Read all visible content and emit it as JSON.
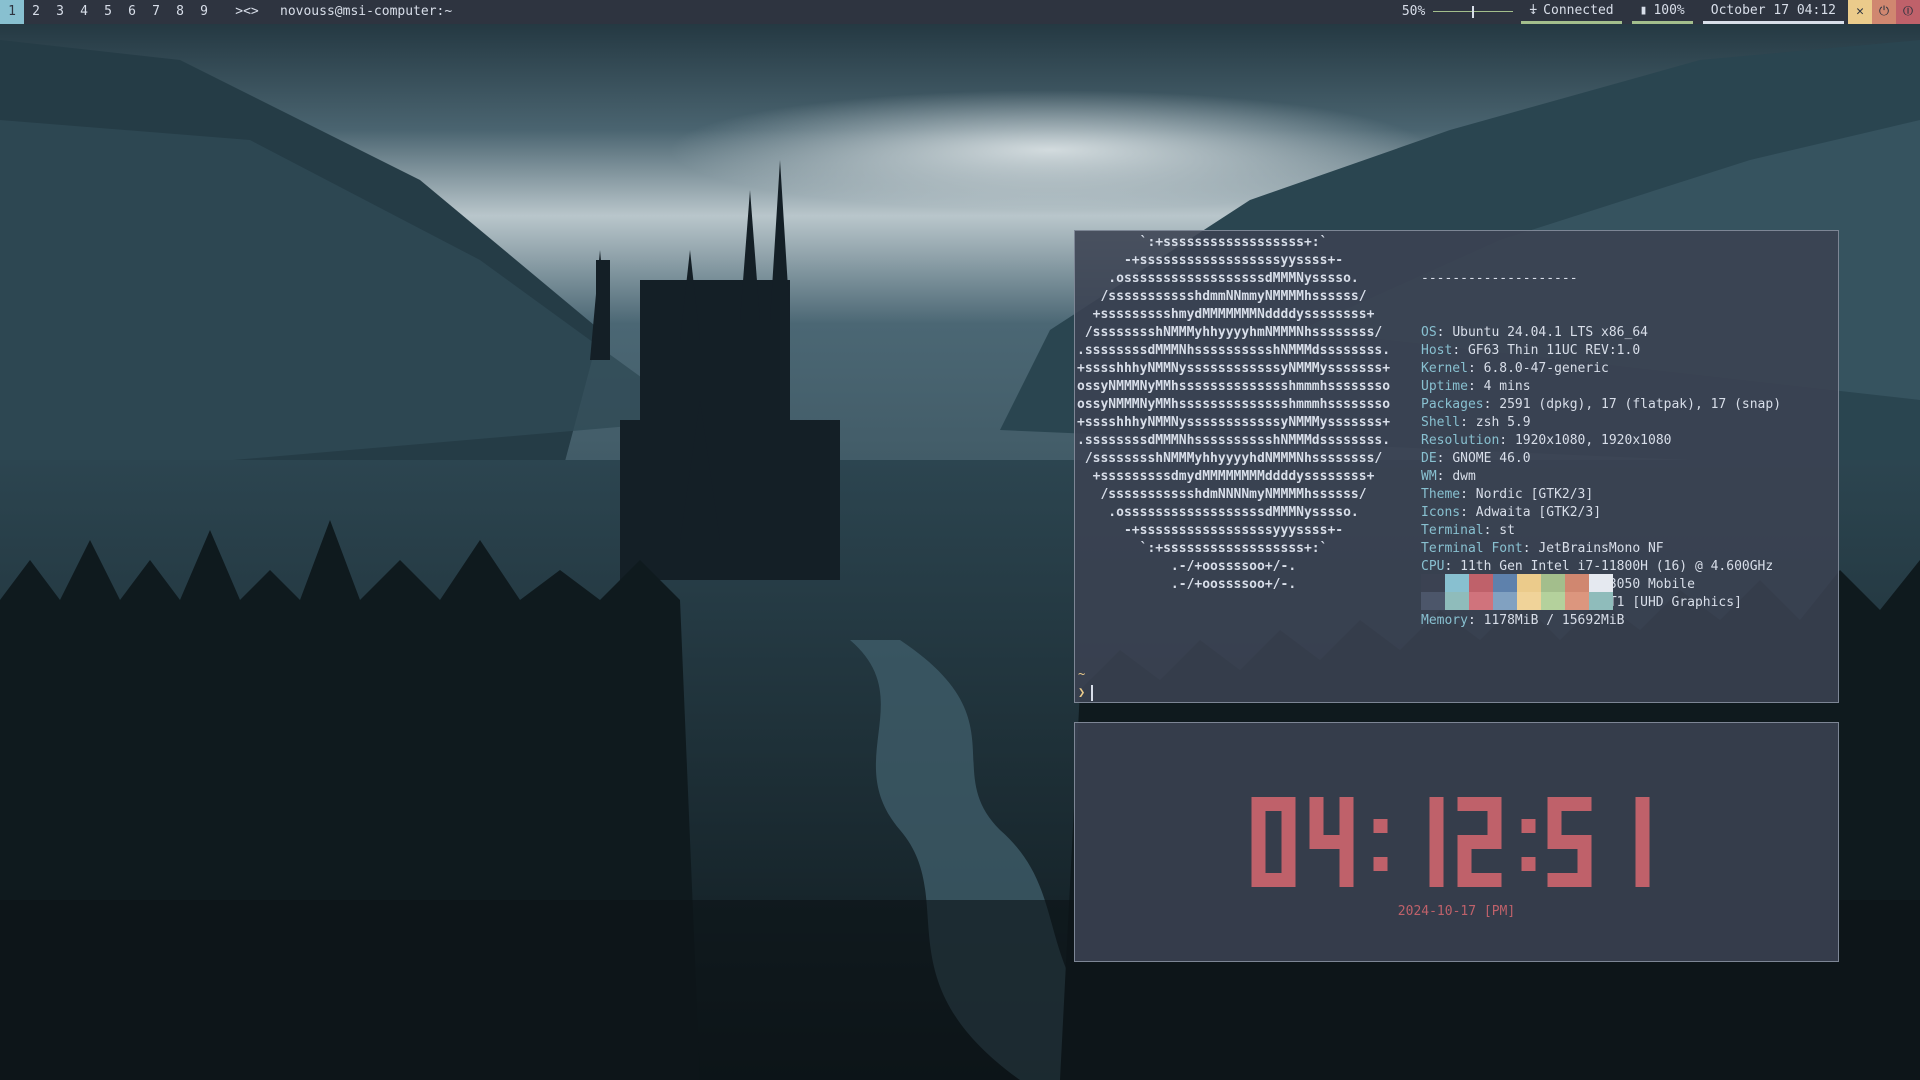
{
  "bar": {
    "tags": [
      "1",
      "2",
      "3",
      "4",
      "5",
      "6",
      "7",
      "8",
      "9"
    ],
    "active_tag": "1",
    "layout": "><>",
    "window_title": "novouss@msi-computer:~",
    "volume_text": "50%",
    "volume_level": 0.5,
    "network_icon": "wifi-icon",
    "network_text": "Connected",
    "battery_icon": "battery-icon",
    "battery_text": "100%",
    "date_text": "October 17 04:12",
    "power_close_glyph": "✕",
    "power_lock_glyph": "⏻",
    "power_off_glyph": "⏼"
  },
  "terminal": {
    "ascii_art": [
      "            .-/+oossssoo+/-.",
      "        `:+ssssssssssssssssss+:`",
      "      -+ssssssssssssssssssyyssss+-",
      "    .ossssssssssssssssssdMMMNysssso.",
      "   /ssssssssssshdmmNNmmyNMMMMhssssss/",
      "  +ssssssssshmydMMMMMMMNddddyssssssss+",
      " /sssssssshNMMMyhhyyyyhmNMMMNhssssssss/",
      ".ssssssssdMMMNhsssssssssshNMMMdssssssss.",
      "+sssshhhyNMMNyssssssssssssyNMMMysssssss+",
      "ossyNMMMNyMMhsssssssssssssshmmmhssssssso",
      "ossyNMMMNyMMhsssssssssssssshmmmhssssssso",
      "+sssshhhyNMMNyssssssssssssyNMMMysssssss+",
      ".ssssssssdMMMNhsssssssssshNMMMdssssssss.",
      " /sssssssshNMMMyhhyyyyhdNMMMNhssssssss/",
      "  +sssssssssdmydMMMMMMMMddddyssssssss+",
      "   /ssssssssssshdmNNNNmyNMMMMhssssss/",
      "    .ossssssssssssssssssdMMMNysssso.",
      "      -+sssssssssssssssssyyyssss+-",
      "        `:+ssssssssssssssssss+:`",
      "            .-/+oossssoo+/-."
    ],
    "info_separator": "--------------------",
    "info": [
      {
        "key": "OS",
        "value": "Ubuntu 24.04.1 LTS x86_64"
      },
      {
        "key": "Host",
        "value": "GF63 Thin 11UC REV:1.0"
      },
      {
        "key": "Kernel",
        "value": "6.8.0-47-generic"
      },
      {
        "key": "Uptime",
        "value": "4 mins"
      },
      {
        "key": "Packages",
        "value": "2591 (dpkg), 17 (flatpak), 17 (snap)"
      },
      {
        "key": "Shell",
        "value": "zsh 5.9"
      },
      {
        "key": "Resolution",
        "value": "1920x1080, 1920x1080"
      },
      {
        "key": "DE",
        "value": "GNOME 46.0"
      },
      {
        "key": "WM",
        "value": "dwm"
      },
      {
        "key": "Theme",
        "value": "Nordic [GTK2/3]"
      },
      {
        "key": "Icons",
        "value": "Adwaita [GTK2/3]"
      },
      {
        "key": "Terminal",
        "value": "st"
      },
      {
        "key": "Terminal Font",
        "value": "JetBrainsMono NF"
      },
      {
        "key": "CPU",
        "value": "11th Gen Intel i7-11800H (16) @ 4.600GHz"
      },
      {
        "key": "GPU",
        "value": "NVIDIA GeForce RTX 3050 Mobile"
      },
      {
        "key": "GPU",
        "value": "Intel TigerLake-H GT1 [UHD Graphics]"
      },
      {
        "key": "Memory",
        "value": "1178MiB / 15692MiB"
      }
    ],
    "palette_top": [
      "#3b4252",
      "#88c0d0",
      "#bf616a",
      "#5e81ac",
      "#ebcb8b",
      "#a3be8c",
      "#d08770",
      "#e5e9f0"
    ],
    "palette_bottom": [
      "#4c566a",
      "#8fbcbb",
      "#d0737c",
      "#81a1c1",
      "#f0d399",
      "#b4d19c",
      "#dc967e",
      "#8fbcbb"
    ],
    "prompt_dir": "~",
    "prompt_symbol": "❯"
  },
  "clock": {
    "time": "04:12:51",
    "date": "2024-10-17 [PM]",
    "color": "#bf616a"
  }
}
